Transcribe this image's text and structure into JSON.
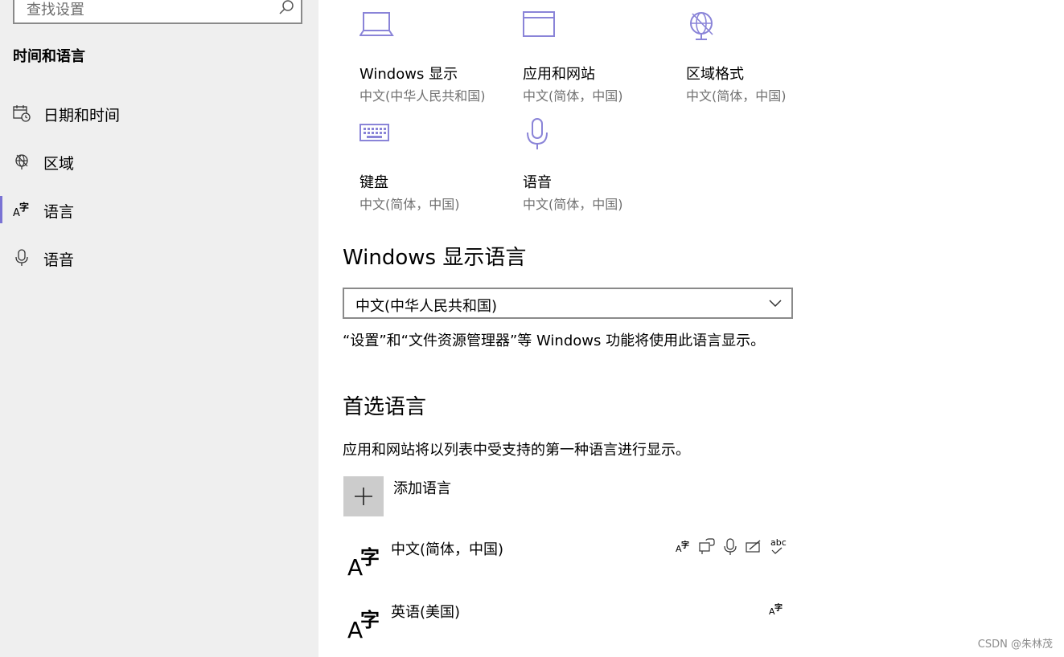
{
  "sidebar": {
    "search_placeholder": "查找设置",
    "section_title": "时间和语言",
    "items": [
      {
        "label": "日期和时间",
        "icon": "calendar-clock-icon",
        "selected": false
      },
      {
        "label": "区域",
        "icon": "globe-icon",
        "selected": false
      },
      {
        "label": "语言",
        "icon": "language-icon",
        "selected": true
      },
      {
        "label": "语音",
        "icon": "microphone-icon",
        "selected": false
      }
    ]
  },
  "tiles": [
    {
      "title": "Windows 显示",
      "subtitle": "中文(中华人民共和国)",
      "icon": "laptop-icon"
    },
    {
      "title": "应用和网站",
      "subtitle": "中文(简体，中国)",
      "icon": "window-icon"
    },
    {
      "title": "区域格式",
      "subtitle": "中文(简体，中国)",
      "icon": "globe-icon"
    },
    {
      "title": "键盘",
      "subtitle": "中文(简体，中国)",
      "icon": "keyboard-icon"
    },
    {
      "title": "语音",
      "subtitle": "中文(简体，中国)",
      "icon": "microphone-icon"
    }
  ],
  "display_language": {
    "heading": "Windows 显示语言",
    "selected": "中文(中华人民共和国)",
    "description": "“设置”和“文件资源管理器”等 Windows 功能将使用此语言显示。"
  },
  "preferred": {
    "heading": "首选语言",
    "description": "应用和网站将以列表中受支持的第一种语言进行显示。",
    "add_label": "添加语言",
    "languages": [
      {
        "name": "中文(简体，中国)",
        "features": [
          "language-pack-icon",
          "speech-bubble-icon",
          "microphone-icon",
          "handwriting-icon",
          "spelling-icon"
        ]
      },
      {
        "name": "英语(美国)",
        "features": [
          "language-pack-icon"
        ]
      }
    ],
    "spelling_text": "abc",
    "glyph_a": "A",
    "glyph_zi": "字"
  },
  "watermark": "CSDN @朱林茂",
  "colors": {
    "accent": "#7a73d4",
    "sidebar_bg": "#efefef",
    "add_btn_bg": "#cccccc",
    "subtle_text": "#707070"
  }
}
